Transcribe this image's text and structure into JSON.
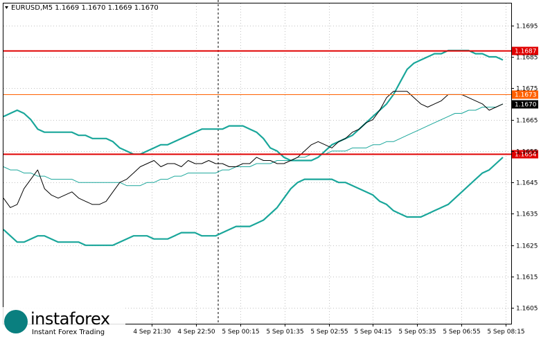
{
  "chart_data": {
    "type": "line",
    "title": "EURUSD,M5  1.1669 1.1670 1.1669 1.1670",
    "ylim": [
      1.16,
      1.1702
    ],
    "y_ticks": [
      "1.1695",
      "1.1685",
      "1.1675",
      "1.1665",
      "1.1655",
      "1.1645",
      "1.1635",
      "1.1625",
      "1.1615",
      "1.1605"
    ],
    "x_ticks": [
      "4 Sep 21:30",
      "4 Sep 22:50",
      "5 Sep 00:15",
      "5 Sep 01:35",
      "5 Sep 02:55",
      "5 Sep 04:15",
      "5 Sep 05:35",
      "5 Sep 06:55",
      "5 Sep 08:15"
    ],
    "levels": [
      {
        "value": 1.1687,
        "label": "1.1687",
        "color": "#e00000"
      },
      {
        "value": 1.1673,
        "label": "1.1673",
        "color": "#ff6000"
      },
      {
        "value": 1.167,
        "label": "1.1670",
        "color": "#000000"
      },
      {
        "value": 1.1654,
        "label": "1.1654",
        "color": "#e00000"
      }
    ],
    "series": [
      {
        "color": "#19a69a",
        "values": [
          1.1666,
          1.1667,
          1.1668,
          1.1667,
          1.1665,
          1.1662,
          1.1661,
          1.1661,
          1.1661,
          1.1661,
          1.1661,
          1.166,
          1.166,
          1.1659,
          1.1659,
          1.1659,
          1.1658,
          1.1656,
          1.1655,
          1.1654,
          1.1654,
          1.1655,
          1.1656,
          1.1657,
          1.1657,
          1.1658,
          1.1659,
          1.166,
          1.1661,
          1.1662,
          1.1662,
          1.1662,
          1.1662,
          1.1663,
          1.1663,
          1.1663,
          1.1662,
          1.1661,
          1.1659,
          1.1656,
          1.1655,
          1.1653,
          1.1652,
          1.1652,
          1.1652,
          1.1652,
          1.1653,
          1.1655,
          1.1657,
          1.1658,
          1.1659,
          1.166,
          1.1662,
          1.1664,
          1.1666,
          1.1668,
          1.167,
          1.1673,
          1.1677,
          1.1681,
          1.1683,
          1.1684,
          1.1685,
          1.1686,
          1.1686,
          1.1687,
          1.1687,
          1.1687,
          1.1687,
          1.1686,
          1.1686,
          1.1685,
          1.1685,
          1.1684
        ]
      },
      {
        "color": "#19a69a",
        "values": [
          1.165,
          1.1649,
          1.1649,
          1.1648,
          1.1648,
          1.1647,
          1.1647,
          1.1646,
          1.1646,
          1.1646,
          1.1646,
          1.1645,
          1.1645,
          1.1645,
          1.1645,
          1.1645,
          1.1645,
          1.1645,
          1.1644,
          1.1644,
          1.1644,
          1.1645,
          1.1645,
          1.1646,
          1.1646,
          1.1647,
          1.1647,
          1.1648,
          1.1648,
          1.1648,
          1.1648,
          1.1648,
          1.1649,
          1.1649,
          1.165,
          1.165,
          1.165,
          1.1651,
          1.1651,
          1.1651,
          1.1652,
          1.1652,
          1.1652,
          1.1653,
          1.1653,
          1.1654,
          1.1654,
          1.1654,
          1.1655,
          1.1655,
          1.1655,
          1.1656,
          1.1656,
          1.1656,
          1.1657,
          1.1657,
          1.1658,
          1.1658,
          1.1659,
          1.166,
          1.1661,
          1.1662,
          1.1663,
          1.1664,
          1.1665,
          1.1666,
          1.1667,
          1.1667,
          1.1668,
          1.1668,
          1.1669,
          1.1669,
          1.1669,
          1.167
        ]
      },
      {
        "color": "#19a69a",
        "values": [
          1.163,
          1.1628,
          1.1626,
          1.1626,
          1.1627,
          1.1628,
          1.1628,
          1.1627,
          1.1626,
          1.1626,
          1.1626,
          1.1626,
          1.1625,
          1.1625,
          1.1625,
          1.1625,
          1.1625,
          1.1626,
          1.1627,
          1.1628,
          1.1628,
          1.1628,
          1.1627,
          1.1627,
          1.1627,
          1.1628,
          1.1629,
          1.1629,
          1.1629,
          1.1628,
          1.1628,
          1.1628,
          1.1629,
          1.163,
          1.1631,
          1.1631,
          1.1631,
          1.1632,
          1.1633,
          1.1635,
          1.1637,
          1.164,
          1.1643,
          1.1645,
          1.1646,
          1.1646,
          1.1646,
          1.1646,
          1.1646,
          1.1645,
          1.1645,
          1.1644,
          1.1643,
          1.1642,
          1.1641,
          1.1639,
          1.1638,
          1.1636,
          1.1635,
          1.1634,
          1.1634,
          1.1634,
          1.1635,
          1.1636,
          1.1637,
          1.1638,
          1.164,
          1.1642,
          1.1644,
          1.1646,
          1.1648,
          1.1649,
          1.1651,
          1.1653
        ]
      },
      {
        "color": "#000000",
        "values": [
          1.164,
          1.1637,
          1.1638,
          1.1643,
          1.1646,
          1.1649,
          1.1643,
          1.1641,
          1.164,
          1.1641,
          1.1642,
          1.164,
          1.1639,
          1.1638,
          1.1638,
          1.1639,
          1.1642,
          1.1645,
          1.1646,
          1.1648,
          1.165,
          1.1651,
          1.1652,
          1.165,
          1.1651,
          1.1651,
          1.165,
          1.1652,
          1.1651,
          1.1651,
          1.1652,
          1.1651,
          1.1651,
          1.165,
          1.165,
          1.1651,
          1.1651,
          1.1653,
          1.1652,
          1.1652,
          1.1651,
          1.1651,
          1.1652,
          1.1653,
          1.1655,
          1.1657,
          1.1658,
          1.1657,
          1.1656,
          1.1658,
          1.1659,
          1.1661,
          1.1662,
          1.1664,
          1.1665,
          1.1668,
          1.1672,
          1.1674,
          1.1674,
          1.1674,
          1.1672,
          1.167,
          1.1669,
          1.167,
          1.1671,
          1.1673,
          1.1673,
          1.1673,
          1.1672,
          1.1671,
          1.167,
          1.1668,
          1.1669,
          1.167
        ]
      }
    ]
  },
  "logo": {
    "name": "instaforex",
    "tagline": "Instant Forex Trading"
  }
}
